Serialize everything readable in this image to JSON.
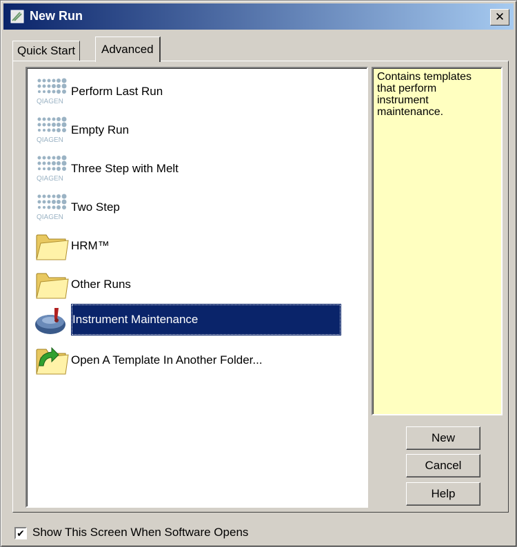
{
  "window": {
    "title": "New Run",
    "close_label": "✕"
  },
  "tabs": [
    {
      "label": "Quick Start",
      "active": false
    },
    {
      "label": "Advanced",
      "active": true
    }
  ],
  "list": {
    "items": [
      {
        "label": "Perform Last Run",
        "icon": "qiagen-logo-icon"
      },
      {
        "label": "Empty Run",
        "icon": "qiagen-logo-icon"
      },
      {
        "label": "Three Step with Melt",
        "icon": "qiagen-logo-icon"
      },
      {
        "label": "Two Step",
        "icon": "qiagen-logo-icon"
      },
      {
        "label": "HRM™",
        "icon": "folder-icon"
      },
      {
        "label": "Other Runs",
        "icon": "folder-icon"
      },
      {
        "label": "Instrument Maintenance",
        "icon": "instrument-maintenance-icon",
        "selected": true
      },
      {
        "label": "Open A Template In Another Folder...",
        "icon": "open-folder-icon"
      }
    ]
  },
  "description": {
    "text": "Contains templates\nthat perform\ninstrument\nmaintenance."
  },
  "buttons": {
    "new": "New",
    "cancel": "Cancel",
    "help": "Help"
  },
  "footer": {
    "checkbox_checked": true,
    "checkbox_mark": "✔",
    "checkbox_label": "Show This Screen When Software Opens"
  },
  "colors": {
    "selection": "#0a246a",
    "description_bg": "#ffffc0",
    "title_bar": "#0a246a"
  }
}
